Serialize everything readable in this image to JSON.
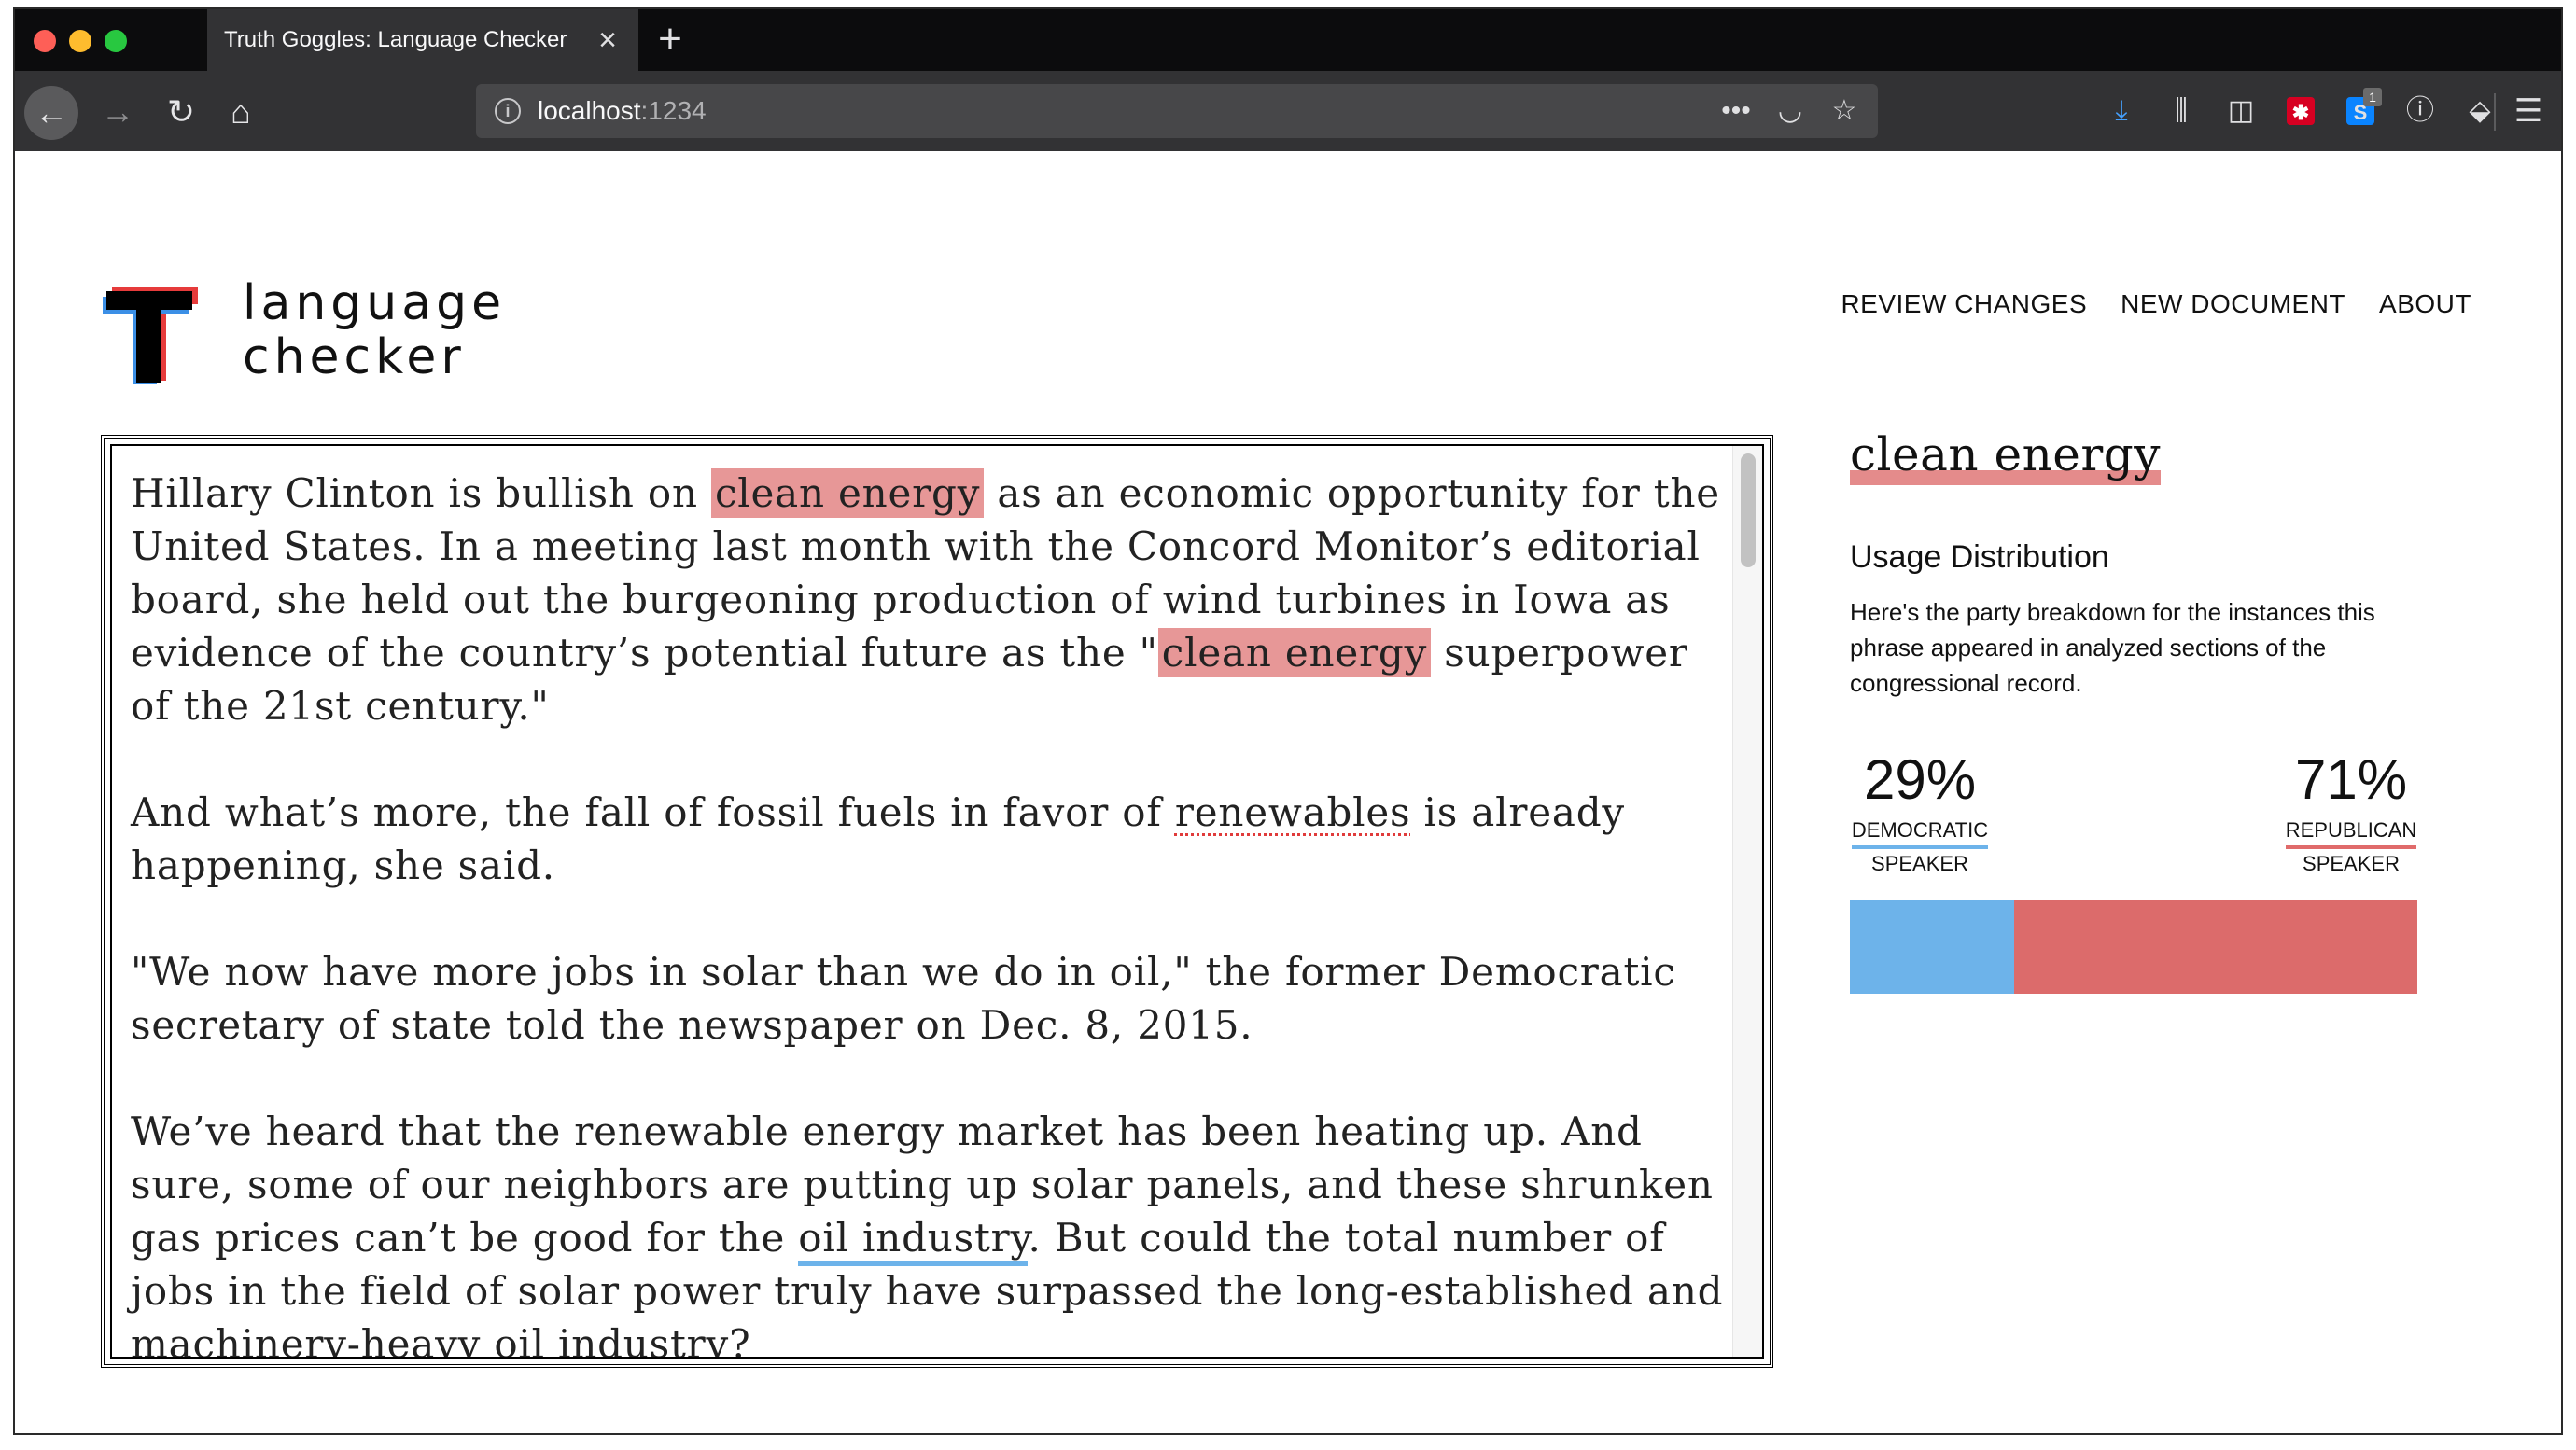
{
  "browser": {
    "tab_title": "Truth Goggles: Language Checker",
    "url_host": "localhost",
    "url_port": ":1234",
    "extension_badge": "1"
  },
  "brand": {
    "line1": "language",
    "line2": "checker"
  },
  "nav": {
    "items": [
      "REVIEW CHANGES",
      "NEW DOCUMENT",
      "ABOUT"
    ]
  },
  "editor": {
    "p1": {
      "a": "Hillary Clinton is bullish on ",
      "h1": "clean energy",
      "b": " as an economic opportunity for the United States. In a meeting last month with the Concord Monitor’s editorial board, she held out the burgeoning production of wind turbines in Iowa as evidence of the country’s potential future as the \"",
      "h2": "clean energy",
      "c": " superpower of the 21st century.\""
    },
    "p2": {
      "a": "And what’s more, the fall of fossil fuels in favor of ",
      "u": "renewables",
      "b": " is already happening, she said."
    },
    "p3": "\"We now have more jobs in solar than we do in oil,\" the former Democratic secretary of state told the newspaper on Dec. 8, 2015.",
    "p4": {
      "a": "We’ve heard that the renewable energy market has been heating up. And sure, some of our neighbors are putting up solar panels, and these shrunken gas prices can’t be good for the ",
      "u1": "oil industry",
      "b": ". But could the total number of jobs in the field of solar power truly have surpassed the long-established and machinery-heavy ",
      "u2": "oil industry",
      "c": "?"
    }
  },
  "sidebar": {
    "phrase": "clean energy",
    "usage_title": "Usage Distribution",
    "usage_desc": "Here's the party breakdown for the instances this phrase appeared in analyzed sections of the congressional record.",
    "democratic": {
      "pct": "29%",
      "party": "DEMOCRATIC",
      "role": "SPEAKER",
      "value": 29
    },
    "republican": {
      "pct": "71%",
      "party": "REPUBLICAN",
      "role": "SPEAKER",
      "value": 71
    }
  },
  "colors": {
    "democratic": "#6db3ea",
    "republican": "#dc6b6b",
    "highlight": "#e79797"
  }
}
